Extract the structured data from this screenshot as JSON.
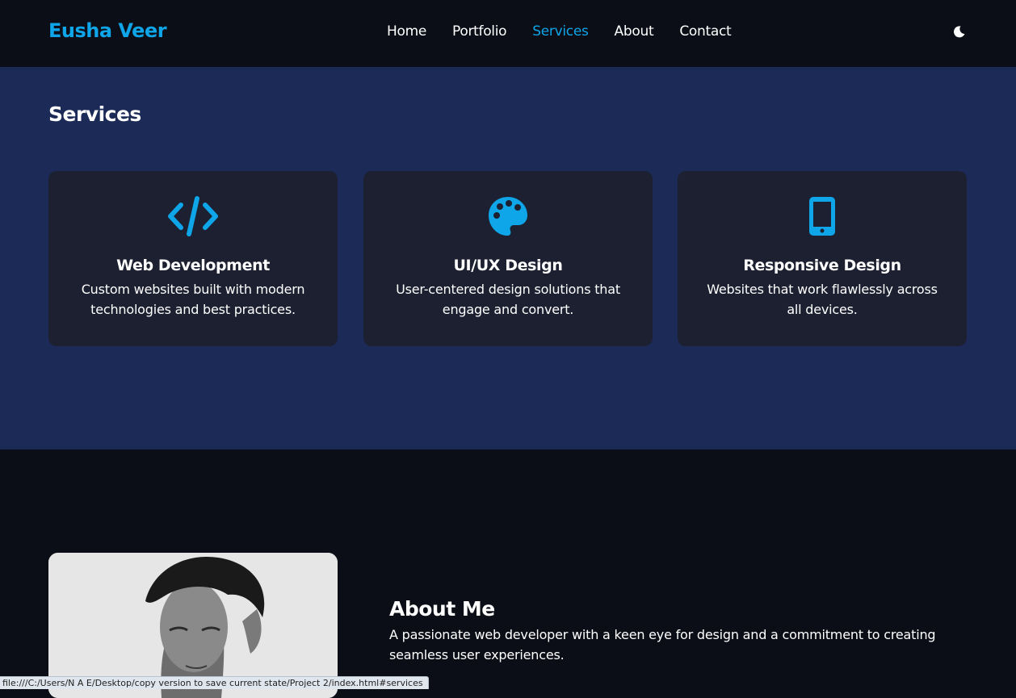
{
  "header": {
    "logo": "Eusha Veer",
    "nav": [
      "Home",
      "Portfolio",
      "Services",
      "About",
      "Contact"
    ],
    "active_nav": "Services",
    "theme_icon": "moon-icon"
  },
  "services": {
    "title": "Services",
    "cards": [
      {
        "icon": "code-icon",
        "title": "Web Development",
        "description": "Custom websites built with modern technologies and best practices."
      },
      {
        "icon": "palette-icon",
        "title": "UI/UX Design",
        "description": "User-centered design solutions that engage and convert."
      },
      {
        "icon": "mobile-icon",
        "title": "Responsive Design",
        "description": "Websites that work flawlessly across all devices."
      }
    ]
  },
  "about": {
    "title": "About Me",
    "text": "A passionate web developer with a keen eye for design and a commitment to creating seamless user experiences."
  },
  "statusbar": {
    "url": "file:///C:/Users/N A E/Desktop/copy version to save current state/Project 2/index.html#services"
  },
  "colors": {
    "accent": "#0ea5e9",
    "header_bg": "#0b0e16",
    "services_bg": "#1b2a57",
    "card_bg": "#1c2030"
  }
}
